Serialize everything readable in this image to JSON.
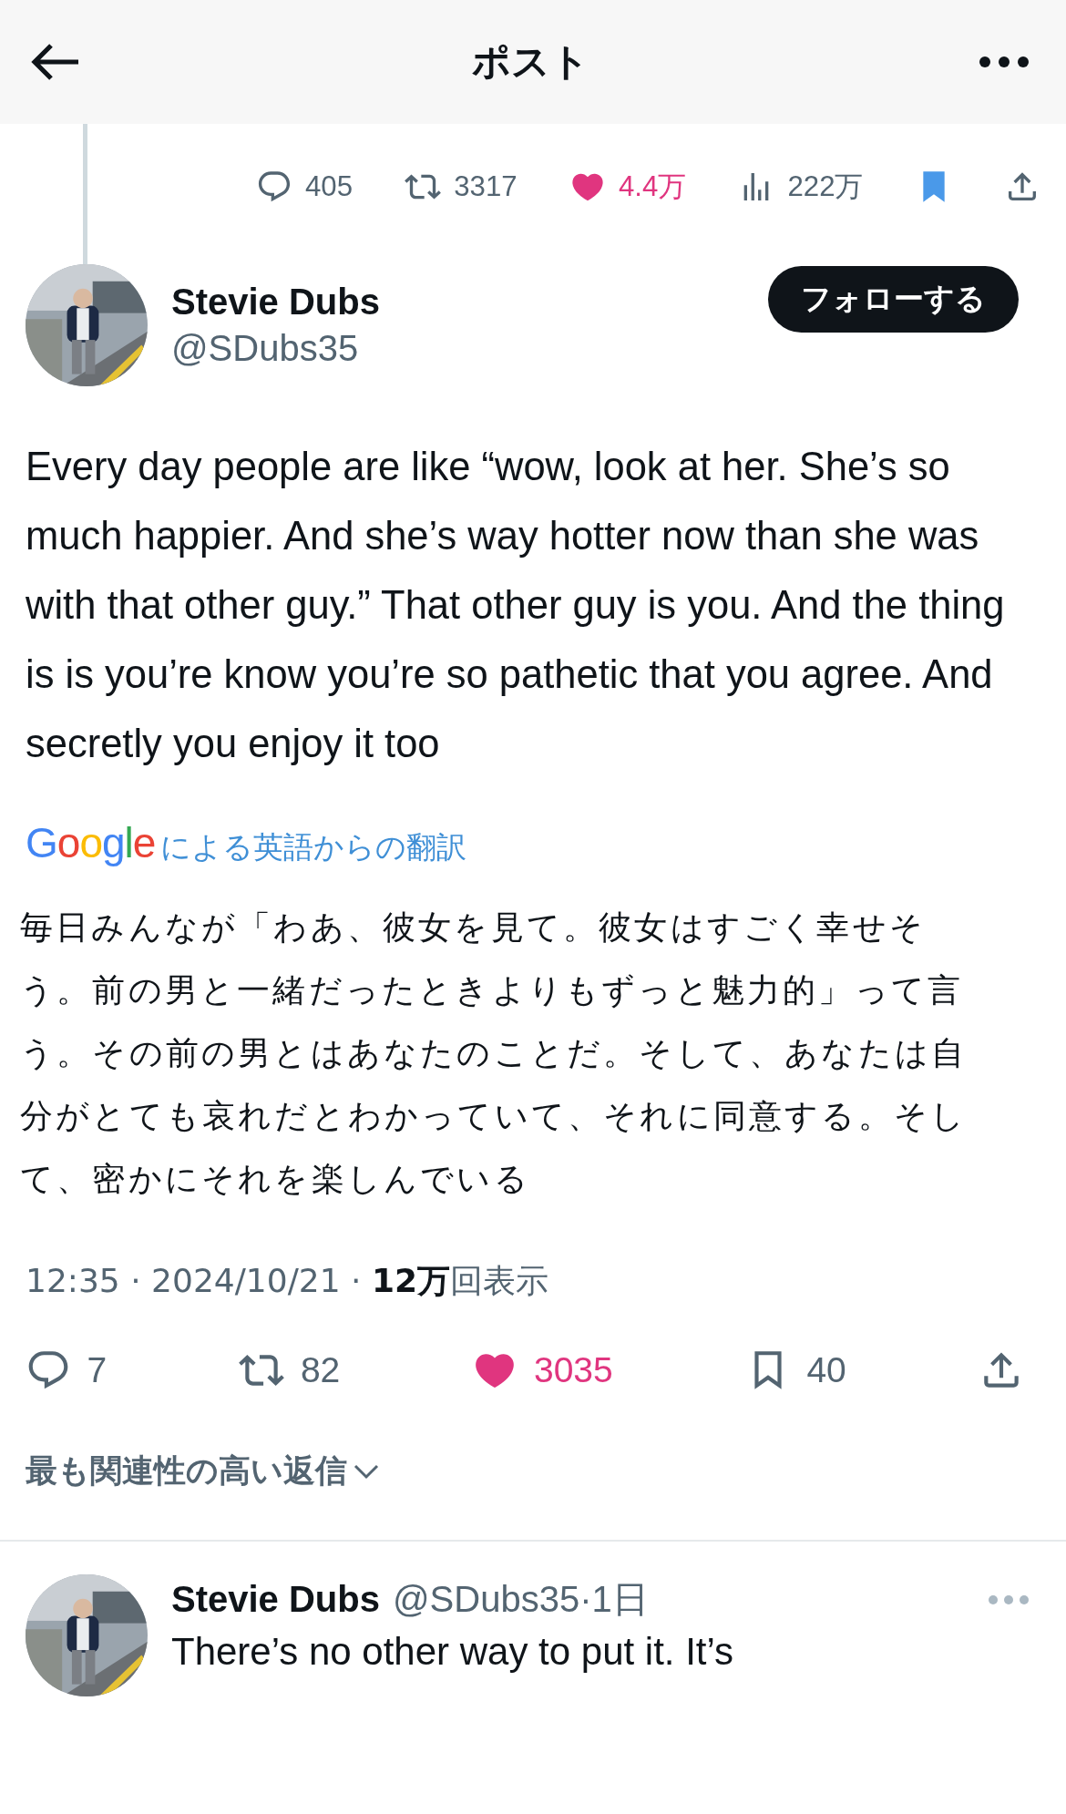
{
  "header": {
    "title": "ポスト"
  },
  "parent_post": {
    "stats": [
      {
        "kind": "reply",
        "count": "405"
      },
      {
        "kind": "repost",
        "count": "3317"
      },
      {
        "kind": "like",
        "count": "4.4万",
        "liked": true
      },
      {
        "kind": "views",
        "count": "222万"
      },
      {
        "kind": "bookmark",
        "bookmarked": true
      },
      {
        "kind": "share"
      }
    ]
  },
  "post": {
    "author": {
      "name": "Stevie Dubs",
      "handle": "@SDubs35"
    },
    "follow_button": "フォローする",
    "text": "Every day people are like “wow, look at her. She’s so much happier. And she’s way hotter now than she was with that other guy.” That other guy is you. And the thing is is you’re know you’re so pathetic that you agree. And secretly you enjoy it too",
    "translation": {
      "brand": "Google",
      "label": "による英語からの翻訳",
      "text": "毎日みんなが「わあ、彼女を見て。彼女はすごく幸せそう。前の男と一緒だったときよりもずっと魅力的」って言う。その前の男とはあなたのことだ。そして、あなたは自分がとても哀れだとわかっていて、それに同意する。そして、密かにそれを楽しんでいる"
    },
    "meta": "12:35 · 2024/10/21 · **12万**回表示",
    "stats": [
      {
        "kind": "reply",
        "count": "7"
      },
      {
        "kind": "repost",
        "count": "82"
      },
      {
        "kind": "like",
        "count": "3035",
        "liked": true
      },
      {
        "kind": "bookmark",
        "count": "40",
        "bookmarked": false
      },
      {
        "kind": "share"
      }
    ]
  },
  "replies_filter": "最も関連性の高い返信",
  "replies": [
    {
      "name": "Stevie Dubs",
      "meta": "@SDubs35·1日",
      "text": "There’s no other way to put it. It’s"
    }
  ]
}
